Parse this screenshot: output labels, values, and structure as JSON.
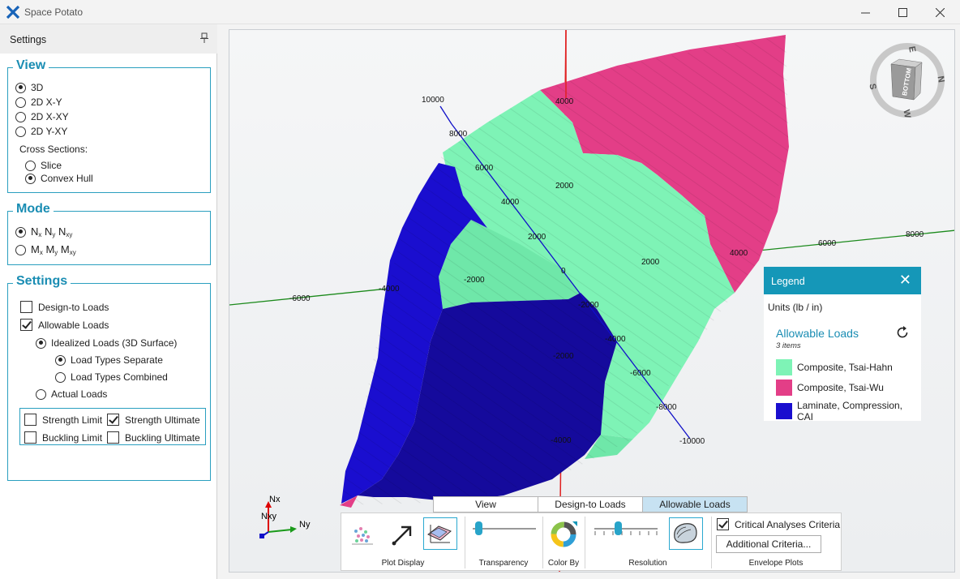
{
  "window": {
    "title": "Space Potato"
  },
  "settings_panel": {
    "title": "Settings",
    "view": {
      "title": "View",
      "options": [
        "3D",
        "2D X-Y",
        "2D X-XY",
        "2D Y-XY"
      ],
      "selected": "3D",
      "cross_sections_label": "Cross Sections:",
      "cross_options": [
        "Slice",
        "Convex Hull"
      ],
      "cross_selected": "Convex Hull"
    },
    "mode": {
      "title": "Mode",
      "option1": {
        "a": "N",
        "as": "x",
        "b": " N",
        "bs": "y",
        "c": " N",
        "cs": "xy"
      },
      "option2": {
        "a": "M",
        "as": "x",
        "b": " M",
        "bs": "y",
        "c": " M",
        "cs": "xy"
      },
      "selected": 0
    },
    "settings": {
      "title": "Settings",
      "design_to_loads": "Design-to Loads",
      "allowable_loads": "Allowable Loads",
      "idealized": "Idealized Loads (3D Surface)",
      "separate": "Load Types Separate",
      "combined": "Load Types Combined",
      "actual": "Actual Loads",
      "strength_limit": "Strength Limit",
      "strength_ultimate": "Strength Ultimate",
      "buckling_limit": "Buckling Limit",
      "buckling_ultimate": "Buckling Ultimate"
    }
  },
  "axis_labels": {
    "vertical": [
      "4000",
      "2000",
      "2000",
      "0",
      "-2000",
      "-4000"
    ],
    "green": [
      "-6000",
      "-4000",
      "2000",
      "4000",
      "6000",
      "8000"
    ],
    "blue": [
      "10000",
      "8000",
      "6000",
      "4000",
      "2000",
      "-2000",
      "-4000",
      "-6000",
      "-8000",
      "-10000"
    ]
  },
  "nav_cube": {
    "face_label": "BOTTOM",
    "dirs": [
      "E",
      "N",
      "S",
      "W"
    ]
  },
  "legend": {
    "title": "Legend",
    "units": "Units (lb / in)",
    "heading": "Allowable Loads",
    "count": "3 items",
    "items": [
      {
        "label": "Composite, Tsai-Hahn",
        "color": "#7ef3b6"
      },
      {
        "label": "Composite, Tsai-Wu",
        "color": "#e33e87"
      },
      {
        "label": "Laminate, Compression, CAI",
        "color": "#1a0ecf"
      }
    ]
  },
  "axes_indicator": {
    "x": "Nx",
    "y": "Ny",
    "z": "Nxy"
  },
  "tabs": [
    "View",
    "Design-to Loads",
    "Allowable Loads"
  ],
  "active_tab": "Allowable Loads",
  "toolbar": {
    "plot_display": "Plot Display",
    "transparency": "Transparency",
    "color_by": "Color By",
    "resolution": "Resolution",
    "envelope_plots": "Envelope Plots",
    "critical": "Critical Analyses Criteria",
    "additional": "Additional Criteria..."
  },
  "colors": {
    "accent": "#1597b8",
    "tsai_hahn": "#7ef3b6",
    "tsai_wu": "#e33e87",
    "cai": "#1a0ecf"
  }
}
